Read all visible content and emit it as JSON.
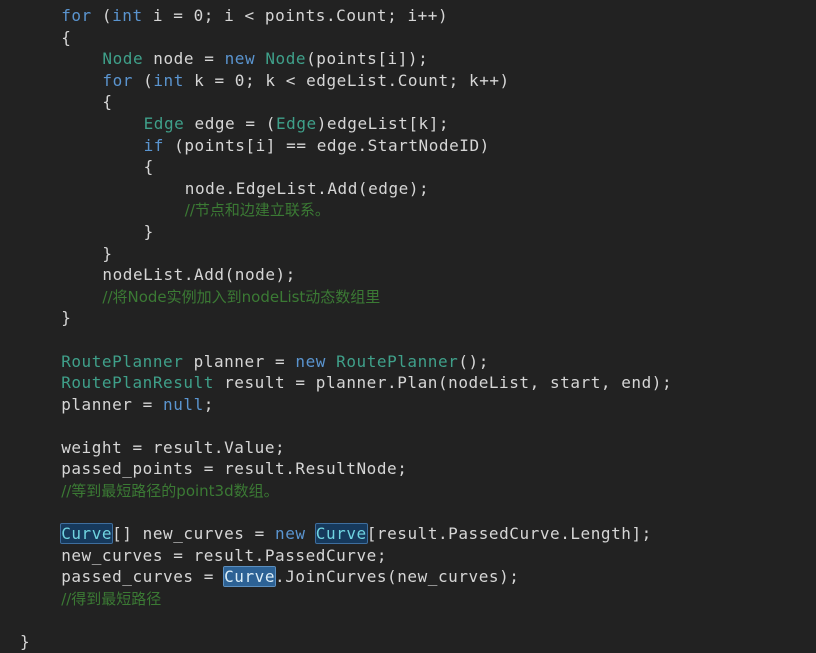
{
  "editor": {
    "language": "csharp",
    "background_color": "#222222",
    "default_text_color": "#D6D6D6",
    "colors": {
      "keyword": "#5A94CF",
      "type": "#3FA08A",
      "comment": "#3B7A34",
      "plain": "#D6D6D6",
      "occurrence_highlight_bg": "#16395C",
      "occurrence_highlight_border": "#3E6E9E",
      "occurrence_highlight_active_bg": "#2D6295",
      "occurrence_highlight_active_border": "#5B8FC0"
    },
    "highlighted_symbol": "Curve",
    "lines": [
      {
        "indent": 2,
        "tokens": [
          {
            "text": "for",
            "kind": "keyword"
          },
          {
            "text": " (",
            "kind": "punct"
          },
          {
            "text": "int",
            "kind": "keyword"
          },
          {
            "text": " i = 0; i < points.Count; i++)",
            "kind": "plain"
          }
        ]
      },
      {
        "indent": 2,
        "tokens": [
          {
            "text": "{",
            "kind": "punct"
          }
        ]
      },
      {
        "indent": 4,
        "tokens": [
          {
            "text": "Node",
            "kind": "type"
          },
          {
            "text": " node = ",
            "kind": "plain"
          },
          {
            "text": "new",
            "kind": "keyword"
          },
          {
            "text": " ",
            "kind": "plain"
          },
          {
            "text": "Node",
            "kind": "type"
          },
          {
            "text": "(points[i]);",
            "kind": "plain"
          }
        ]
      },
      {
        "indent": 4,
        "tokens": [
          {
            "text": "for",
            "kind": "keyword"
          },
          {
            "text": " (",
            "kind": "punct"
          },
          {
            "text": "int",
            "kind": "keyword"
          },
          {
            "text": " k = 0; k < edgeList.Count; k++)",
            "kind": "plain"
          }
        ]
      },
      {
        "indent": 4,
        "tokens": [
          {
            "text": "{",
            "kind": "punct"
          }
        ]
      },
      {
        "indent": 6,
        "tokens": [
          {
            "text": "Edge",
            "kind": "type"
          },
          {
            "text": " edge = (",
            "kind": "plain"
          },
          {
            "text": "Edge",
            "kind": "type"
          },
          {
            "text": ")edgeList[k];",
            "kind": "plain"
          }
        ]
      },
      {
        "indent": 6,
        "tokens": [
          {
            "text": "if",
            "kind": "keyword"
          },
          {
            "text": " (points[i] == edge.StartNodeID)",
            "kind": "plain"
          }
        ]
      },
      {
        "indent": 6,
        "tokens": [
          {
            "text": "{",
            "kind": "punct"
          }
        ]
      },
      {
        "indent": 8,
        "tokens": [
          {
            "text": "node.EdgeList.Add(edge);",
            "kind": "plain"
          }
        ]
      },
      {
        "indent": 8,
        "tokens": [
          {
            "text": "//节点和边建立联系。",
            "kind": "comment"
          }
        ]
      },
      {
        "indent": 6,
        "tokens": [
          {
            "text": "}",
            "kind": "punct"
          }
        ]
      },
      {
        "indent": 4,
        "tokens": [
          {
            "text": "}",
            "kind": "punct"
          }
        ]
      },
      {
        "indent": 4,
        "tokens": [
          {
            "text": "nodeList.Add(node);",
            "kind": "plain"
          }
        ]
      },
      {
        "indent": 4,
        "tokens": [
          {
            "text": "//将Node实例加入到nodeList动态数组里",
            "kind": "comment"
          }
        ]
      },
      {
        "indent": 2,
        "tokens": [
          {
            "text": "}",
            "kind": "punct"
          }
        ]
      },
      {
        "indent": 0,
        "tokens": []
      },
      {
        "indent": 2,
        "tokens": [
          {
            "text": "RoutePlanner",
            "kind": "type"
          },
          {
            "text": " planner = ",
            "kind": "plain"
          },
          {
            "text": "new",
            "kind": "keyword"
          },
          {
            "text": " ",
            "kind": "plain"
          },
          {
            "text": "RoutePlanner",
            "kind": "type"
          },
          {
            "text": "();",
            "kind": "plain"
          }
        ]
      },
      {
        "indent": 2,
        "tokens": [
          {
            "text": "RoutePlanResult",
            "kind": "type"
          },
          {
            "text": " result = planner.Plan(nodeList, start, end);",
            "kind": "plain"
          }
        ]
      },
      {
        "indent": 2,
        "tokens": [
          {
            "text": "planner = ",
            "kind": "plain"
          },
          {
            "text": "null",
            "kind": "keyword"
          },
          {
            "text": ";",
            "kind": "plain"
          }
        ]
      },
      {
        "indent": 0,
        "tokens": []
      },
      {
        "indent": 2,
        "tokens": [
          {
            "text": "weight = result.Value;",
            "kind": "plain"
          }
        ]
      },
      {
        "indent": 2,
        "tokens": [
          {
            "text": "passed_points = result.ResultNode;",
            "kind": "plain"
          }
        ]
      },
      {
        "indent": 2,
        "tokens": [
          {
            "text": "//等到最短路径的point3d数组。",
            "kind": "comment"
          }
        ]
      },
      {
        "indent": 0,
        "tokens": []
      },
      {
        "indent": 2,
        "tokens": [
          {
            "text": "Curve",
            "kind": "highlight"
          },
          {
            "text": "[] new_curves = ",
            "kind": "plain"
          },
          {
            "text": "new",
            "kind": "keyword"
          },
          {
            "text": " ",
            "kind": "plain"
          },
          {
            "text": "Curve",
            "kind": "highlight"
          },
          {
            "text": "[result.PassedCurve.Length];",
            "kind": "plain"
          }
        ]
      },
      {
        "indent": 2,
        "tokens": [
          {
            "text": "new_curves = result.PassedCurve;",
            "kind": "plain"
          }
        ]
      },
      {
        "indent": 2,
        "tokens": [
          {
            "text": "passed_curves = ",
            "kind": "plain"
          },
          {
            "text": "Curve",
            "kind": "highlight-active"
          },
          {
            "text": ".JoinCurves(new_curves);",
            "kind": "plain"
          }
        ]
      },
      {
        "indent": 2,
        "tokens": [
          {
            "text": "//得到最短路径",
            "kind": "comment"
          }
        ]
      },
      {
        "indent": 0,
        "tokens": []
      },
      {
        "indent": 0,
        "tokens": [
          {
            "text": "}",
            "kind": "punct"
          }
        ]
      }
    ]
  }
}
